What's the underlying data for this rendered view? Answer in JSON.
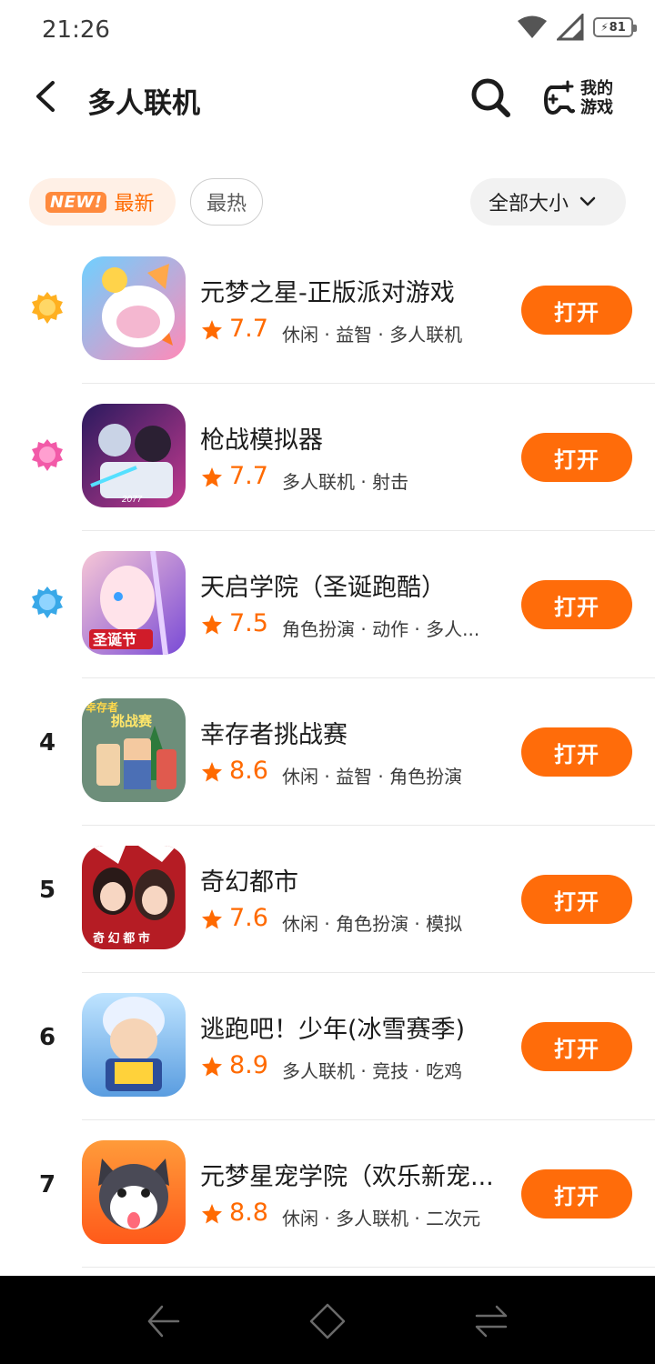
{
  "status_bar": {
    "time": "21:26",
    "battery": "81"
  },
  "header": {
    "title": "多人联机",
    "my_games_line1": "我的",
    "my_games_line2": "游戏"
  },
  "filters": {
    "new_badge": "NEW!",
    "newest": "最新",
    "hottest": "最热",
    "size": "全部大小"
  },
  "open_label": "打开",
  "games": [
    {
      "rank": "1",
      "name": "元梦之星-正版派对游戏",
      "rating": "7.7",
      "tags": "休闲 · 益智 · 多人联机"
    },
    {
      "rank": "2",
      "name": "枪战模拟器",
      "rating": "7.7",
      "tags": "多人联机 · 射击"
    },
    {
      "rank": "3",
      "name": "天启学院（圣诞跑酷）",
      "rating": "7.5",
      "tags": "角色扮演 · 动作 · 多人..."
    },
    {
      "rank": "4",
      "name": "幸存者挑战赛",
      "rating": "8.6",
      "tags": "休闲 · 益智 · 角色扮演"
    },
    {
      "rank": "5",
      "name": "奇幻都市",
      "rating": "7.6",
      "tags": "休闲 · 角色扮演 · 模拟"
    },
    {
      "rank": "6",
      "name": "逃跑吧！少年(冰雪赛季)",
      "rating": "8.9",
      "tags": "多人联机 · 竞技 · 吃鸡"
    },
    {
      "rank": "7",
      "name": "元梦星宠学院（欢乐新宠...",
      "rating": "8.8",
      "tags": "休闲 · 多人联机 · 二次元"
    }
  ],
  "icon_overlays": {
    "game2": "2077",
    "game3": "圣诞节",
    "game4_line1": "幸存者",
    "game4_line2": "挑战赛",
    "game5": "奇 幻 都 市"
  },
  "colors": {
    "accent": "#ff6c0a",
    "rating": "#ff6a00"
  }
}
